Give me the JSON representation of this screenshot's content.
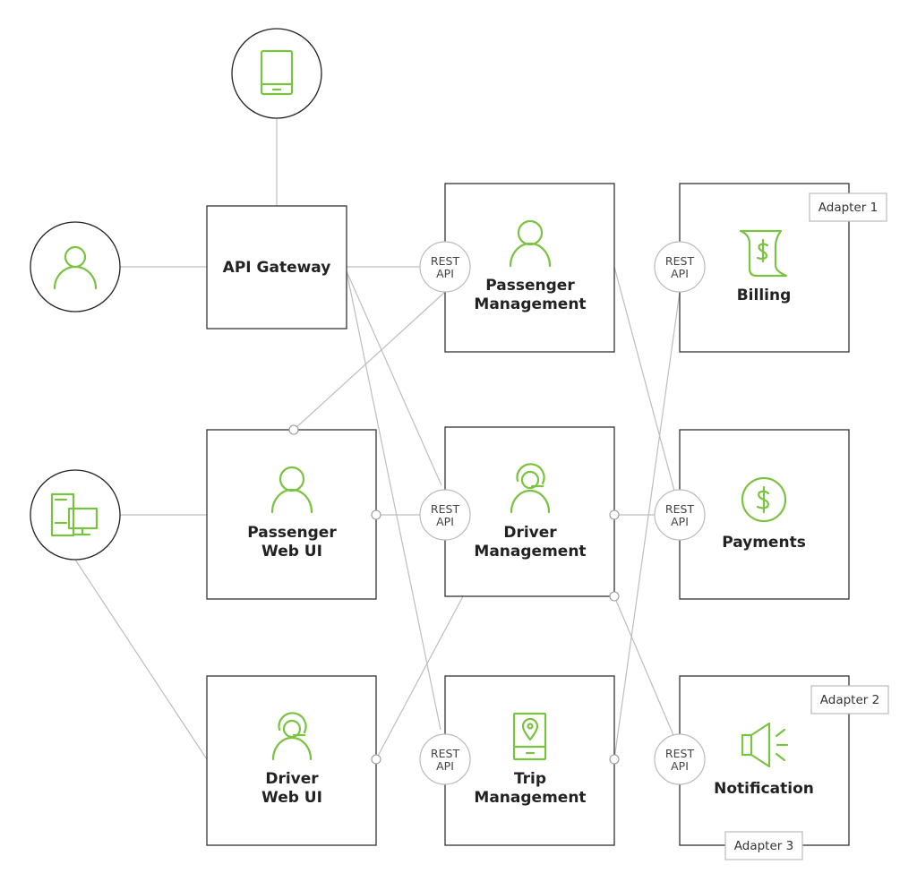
{
  "colors": {
    "accent": "#7cc242",
    "border": "#333333",
    "connector": "#bdbdbd"
  },
  "actors": [
    {
      "id": "mobile",
      "icon": "mobile-device-icon"
    },
    {
      "id": "user",
      "icon": "user-icon"
    },
    {
      "id": "desktop",
      "icon": "desktop-computer-icon"
    }
  ],
  "nodes": {
    "gateway": {
      "line1": "API Gateway"
    },
    "passenger_mgmt": {
      "line1": "Passenger",
      "line2": "Management",
      "icon": "user-icon"
    },
    "billing": {
      "line1": "Billing",
      "icon": "bill-dollar-icon",
      "adapter": "Adapter 1"
    },
    "passenger_web": {
      "line1": "Passenger",
      "line2": "Web UI",
      "icon": "user-icon"
    },
    "driver_mgmt": {
      "line1": "Driver",
      "line2": "Management",
      "icon": "driver-headset-icon"
    },
    "payments": {
      "line1": "Payments",
      "icon": "dollar-coin-icon"
    },
    "driver_web": {
      "line1": "Driver",
      "line2": "Web UI",
      "icon": "driver-headset-icon"
    },
    "trip_mgmt": {
      "line1": "Trip",
      "line2": "Management",
      "icon": "phone-location-icon"
    },
    "notification": {
      "line1": "Notification",
      "icon": "megaphone-icon",
      "adapter": "Adapter 2",
      "adapter2": "Adapter 3"
    }
  },
  "rest": {
    "line1": "REST",
    "line2": "API"
  }
}
